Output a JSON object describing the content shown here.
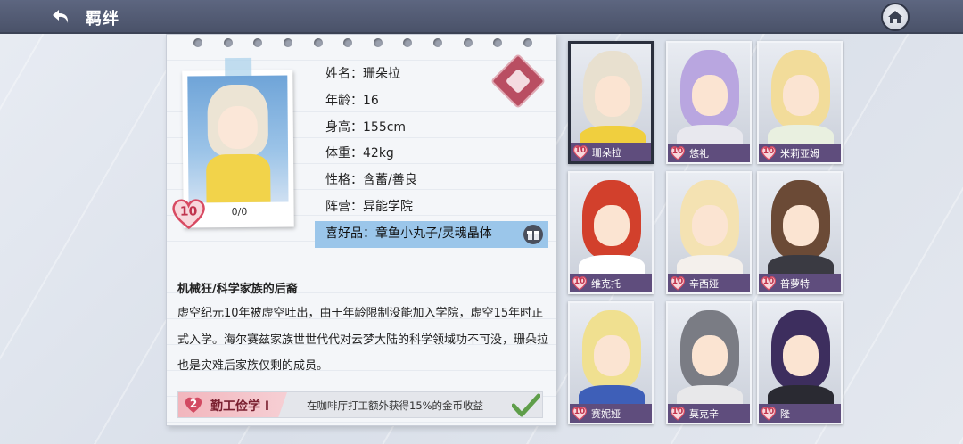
{
  "header": {
    "title": "羁绊"
  },
  "profile": {
    "level": "10",
    "progress": "0/0",
    "rows": [
      {
        "label": "姓名：珊朵拉"
      },
      {
        "label": "年龄：16"
      },
      {
        "label": "身高：155cm"
      },
      {
        "label": "体重：42kg"
      },
      {
        "label": "性格：含蓄/善良"
      },
      {
        "label": "阵营：异能学院"
      },
      {
        "label": "喜好品：章鱼小丸子/灵魂晶体"
      }
    ],
    "bio_title": "机械狂/科学家族的后裔",
    "bio_text": "虚空纪元10年被虚空吐出，由于年龄限制没能加入学院，虚空15年时正式入学。海尔赛兹家族世世代代对云梦大陆的科学领域功不可没，珊朵拉也是灾难后家族仅剩的成员。",
    "skill": {
      "level": "2",
      "name": "勤工俭学 I",
      "desc": "在咖啡厅打工额外获得15%的金币收益"
    }
  },
  "characters": [
    {
      "name": "珊朵拉",
      "level": "10",
      "hair": "#e8e0cf",
      "cloth": "#f0cf3e",
      "selected": true
    },
    {
      "name": "悠礼",
      "level": "10",
      "hair": "#b9a6e0",
      "cloth": "#e8e8ee",
      "selected": false
    },
    {
      "name": "米莉亚姆",
      "level": "10",
      "hair": "#f2dc9a",
      "cloth": "#e9f0e0",
      "selected": false
    },
    {
      "name": "维克托",
      "level": "10",
      "hair": "#d2402c",
      "cloth": "#ffffff",
      "selected": false
    },
    {
      "name": "辛西娅",
      "level": "10",
      "hair": "#f4e2b2",
      "cloth": "#f4f0ec",
      "selected": false
    },
    {
      "name": "普萝特",
      "level": "10",
      "hair": "#6b4a36",
      "cloth": "#3a3a42",
      "selected": false
    },
    {
      "name": "赛妮娅",
      "level": "10",
      "hair": "#f0e090",
      "cloth": "#3e5fb8",
      "selected": false
    },
    {
      "name": "莫克辛",
      "level": "10",
      "hair": "#7a7c84",
      "cloth": "#e8e8ea",
      "selected": false
    },
    {
      "name": "隆",
      "level": "10",
      "hair": "#3d2e5e",
      "cloth": "#2a2a32",
      "selected": false
    }
  ]
}
